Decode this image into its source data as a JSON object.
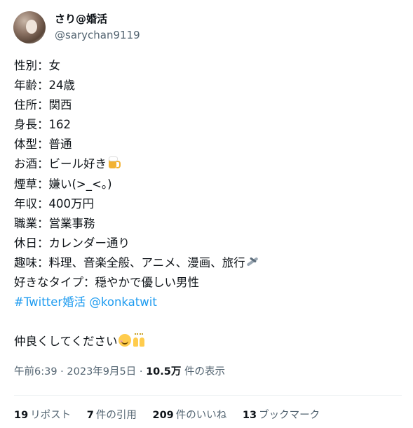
{
  "user": {
    "display_name": "さり@婚活",
    "handle": "@sarychan9119"
  },
  "tweet": {
    "lines": [
      "性別：女",
      "年齢：24歳",
      "住所：関西",
      "身長：162",
      "体型：普通",
      "お酒：ビール好き",
      "煙草：嫌い(>_<。)",
      "年収：400万円",
      "職業：営業事務",
      "休日：カレンダー通り",
      "趣味：料理、音楽全般、アニメ、漫画、旅行",
      "好きなタイプ：穏やかで優しい男性"
    ],
    "hashtag": "#Twitter婚活",
    "mention": "@konkatwit",
    "closing": "仲良くしてください",
    "emoji": {
      "beer": "beer-mug-icon",
      "plane": "airplane-icon",
      "smile": "smiling-face-icon",
      "hands": "raising-hands-icon"
    }
  },
  "meta": {
    "timestamp": "午前6:39 · 2023年9月5日 · ",
    "views_count": "10.5万",
    "views_label": " 件の表示"
  },
  "stats": {
    "reposts": {
      "count": "19",
      "label": "リポスト"
    },
    "quotes": {
      "count": "7",
      "label": "件の引用"
    },
    "likes": {
      "count": "209",
      "label": "件のいいね"
    },
    "bookmarks": {
      "count": "13",
      "label": "ブックマーク"
    }
  }
}
